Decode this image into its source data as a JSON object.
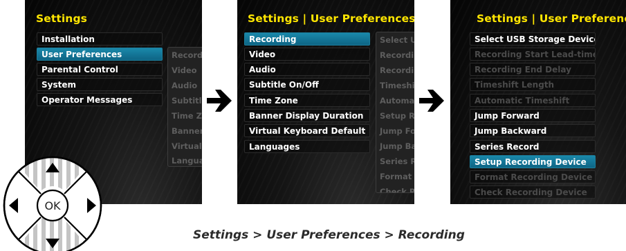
{
  "screens": [
    {
      "title": "Settings",
      "items": [
        "Installation",
        "User Preferences",
        "Parental Control",
        "System",
        "Operator Messages"
      ],
      "selected": 1,
      "submenu": [
        "Recording",
        "Video",
        "Audio",
        "Subtitle On/Off",
        "Time Zone",
        "Banner Display Duration",
        "Virtual Keyboard Default",
        "Languages"
      ]
    },
    {
      "title": "Settings | User Preferences",
      "items": [
        "Recording",
        "Video",
        "Audio",
        "Subtitle On/Off",
        "Time Zone",
        "Banner Display Duration",
        "Virtual Keyboard Default",
        "Languages"
      ],
      "selected": 0,
      "submenu": [
        "Select USB Storage Device",
        "Recording Start Lead-time",
        "Recording End Delay",
        "Timeshift Length",
        "Automatic Timeshift",
        "Setup Recording Device",
        "Jump Forward",
        "Jump Backward",
        "Series Record",
        "Format Recording Device",
        "Check Recording Device"
      ]
    },
    {
      "title": "Settings | User Preferences",
      "items": [
        "Select USB Storage Device",
        "Recording Start Lead-time",
        "Recording End Delay",
        "Timeshift Length",
        "Automatic Timeshift",
        "Jump Forward",
        "Jump Backward",
        "Series Record",
        "Setup Recording Device",
        "Format Recording Device",
        "Check Recording Device"
      ],
      "selected": 8,
      "disabled": [
        1,
        2,
        3,
        4,
        9,
        10
      ]
    }
  ],
  "dpad": {
    "center_label": "OK"
  },
  "caption": "Settings > User Preferences > Recording",
  "colors": {
    "title": "#ffe600",
    "selected": "#127496",
    "arrow": "#000000"
  }
}
